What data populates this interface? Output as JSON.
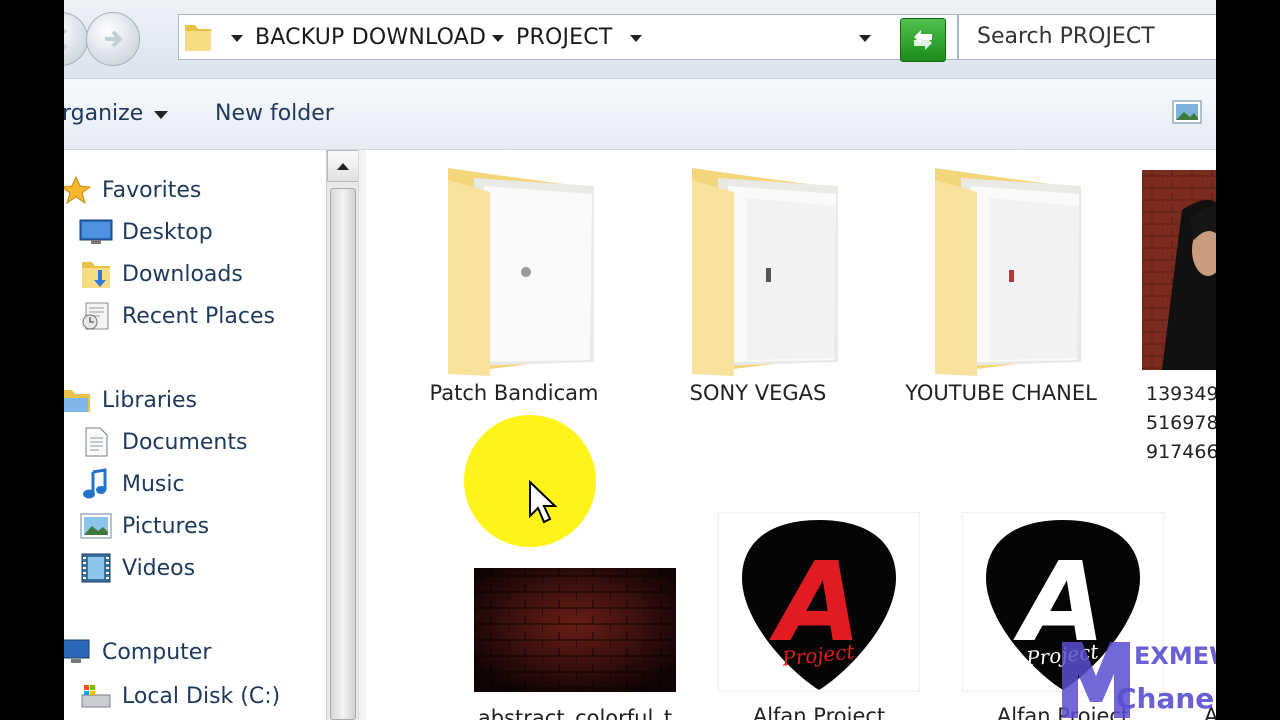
{
  "address_bar": {
    "crumbs": [
      "BACKUP DOWNLOAD",
      "PROJECT"
    ],
    "search_placeholder": "Search PROJECT"
  },
  "command_bar": {
    "organize_label": "rganize",
    "new_folder_label": "New folder"
  },
  "nav_pane": {
    "favorites": {
      "header": "Favorites",
      "items": [
        "Desktop",
        "Downloads",
        "Recent Places"
      ]
    },
    "libraries": {
      "header": "Libraries",
      "items": [
        "Documents",
        "Music",
        "Pictures",
        "Videos"
      ]
    },
    "computer": {
      "header": "Computer",
      "items": [
        "Local Disk (C:)"
      ]
    }
  },
  "files": [
    {
      "name": "Patch Bandicam",
      "type": "folder"
    },
    {
      "name": "SONY VEGAS",
      "type": "folder"
    },
    {
      "name": "YOUTUBE CHANEL",
      "type": "folder"
    },
    {
      "name_lines": [
        "139349",
        "516978",
        "917466"
      ],
      "type": "image"
    },
    {
      "name": "abstract_colorful_t",
      "type": "image"
    },
    {
      "name": "Alfan Project",
      "type": "image",
      "logo_letter": "A",
      "logo_text": "Project",
      "logo_color": "#e11b22"
    },
    {
      "name": "Alfan Project",
      "type": "image",
      "logo_letter": "A",
      "logo_text": "Project",
      "logo_color": "#ffffff"
    },
    {
      "name": "Alfa",
      "type": "image"
    }
  ],
  "watermark": {
    "line1": "EXMEW",
    "line2": "Chanel"
  },
  "colors": {
    "highlight": "#fff200",
    "nav_text": "#1e395b",
    "folder": "#f4d77a"
  }
}
